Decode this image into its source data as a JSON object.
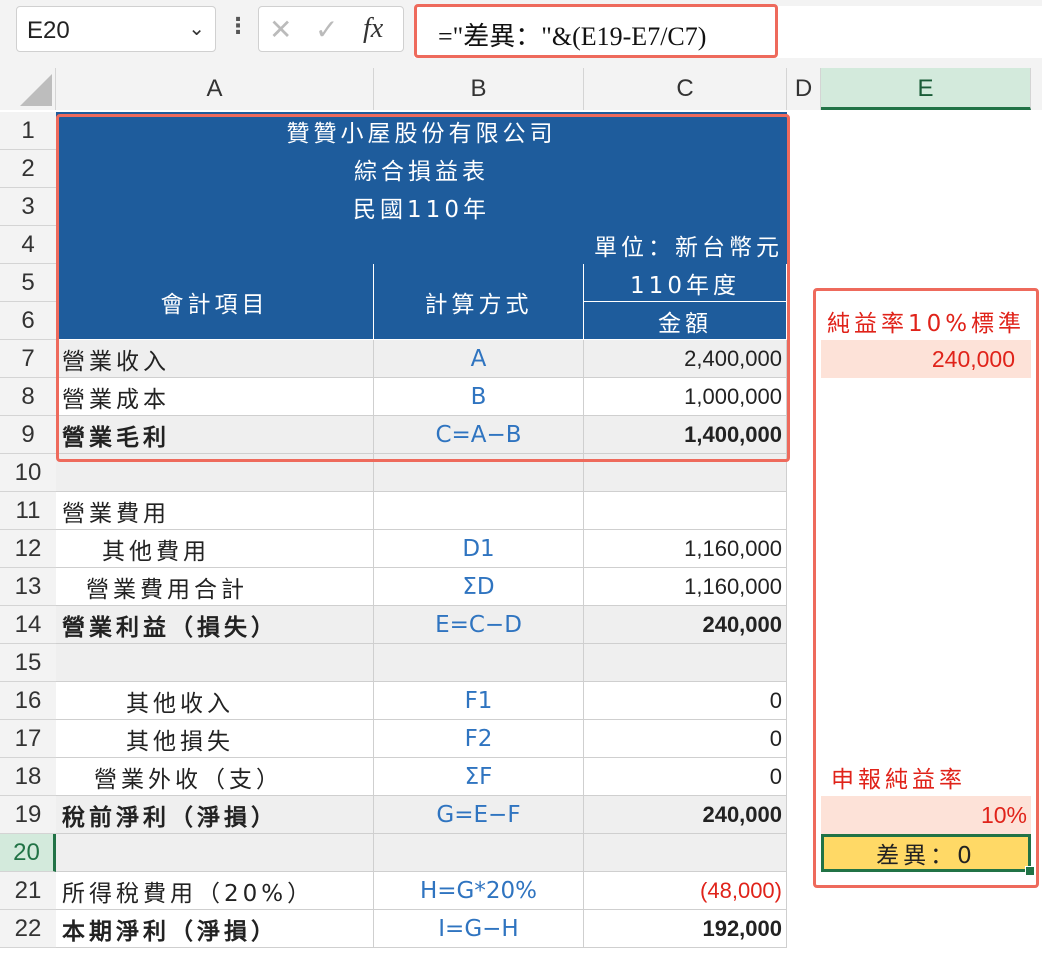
{
  "namebox": {
    "value": "E20",
    "chevron": "chevron-down-icon"
  },
  "formula_bar": {
    "dots": "⋮",
    "cancel": "✕",
    "enter": "✓",
    "fx": "fx",
    "formula": "=\"差異：\"&(E19-E7/C7)"
  },
  "columns": [
    "A",
    "B",
    "C",
    "D",
    "E"
  ],
  "rows": [
    "1",
    "2",
    "3",
    "4",
    "5",
    "6",
    "7",
    "8",
    "9",
    "10",
    "11",
    "12",
    "13",
    "14",
    "15",
    "16",
    "17",
    "18",
    "19",
    "20",
    "21",
    "22"
  ],
  "header": {
    "company": "贊贊小屋股份有限公司",
    "statement": "綜合損益表",
    "period": "民國110年",
    "unit": "單位：新台幣元",
    "col_item": "會計項目",
    "col_method": "計算方式",
    "col_year": "110年度",
    "col_amount": "金額"
  },
  "lines": [
    {
      "row": 7,
      "item": "營業收入",
      "method": "A",
      "amount": "2,400,000"
    },
    {
      "row": 8,
      "item": "營業成本",
      "method": "B",
      "amount": "1,000,000"
    },
    {
      "row": 9,
      "item": "營業毛利",
      "method": "C=A−B",
      "amount": "1,400,000"
    },
    {
      "row": 11,
      "item": "營業費用",
      "method": "",
      "amount": ""
    },
    {
      "row": 12,
      "item": "其他費用",
      "method": "D1",
      "amount": "1,160,000"
    },
    {
      "row": 13,
      "item": "營業費用合計",
      "method": "ΣD",
      "amount": "1,160,000"
    },
    {
      "row": 14,
      "item": "營業利益（損失）",
      "method": "E=C−D",
      "amount": "240,000"
    },
    {
      "row": 16,
      "item": "其他收入",
      "method": "F1",
      "amount": "0"
    },
    {
      "row": 17,
      "item": "其他損失",
      "method": "F2",
      "amount": "0"
    },
    {
      "row": 18,
      "item": "營業外收（支）",
      "method": "ΣF",
      "amount": "0"
    },
    {
      "row": 19,
      "item": "稅前淨利（淨損）",
      "method": "G=E−F",
      "amount": "240,000"
    },
    {
      "row": 21,
      "item": "所得稅費用（20%）",
      "method": "H=G*20%",
      "amount": "(48,000)"
    },
    {
      "row": 22,
      "item": "本期淨利（淨損）",
      "method": "I=G−H",
      "amount": "192,000"
    }
  ],
  "side": {
    "std_label": "純益率10%標準",
    "std_value": "240,000",
    "rate_label": "申報純益率",
    "rate_value": "10%",
    "diff": "差異：0"
  },
  "colors": {
    "header_blue": "#1e5c9c",
    "accent_red": "#ee6a5c",
    "diff_fill": "#ffd966",
    "pink_fill": "#fde2d8",
    "select_green": "#217346"
  }
}
